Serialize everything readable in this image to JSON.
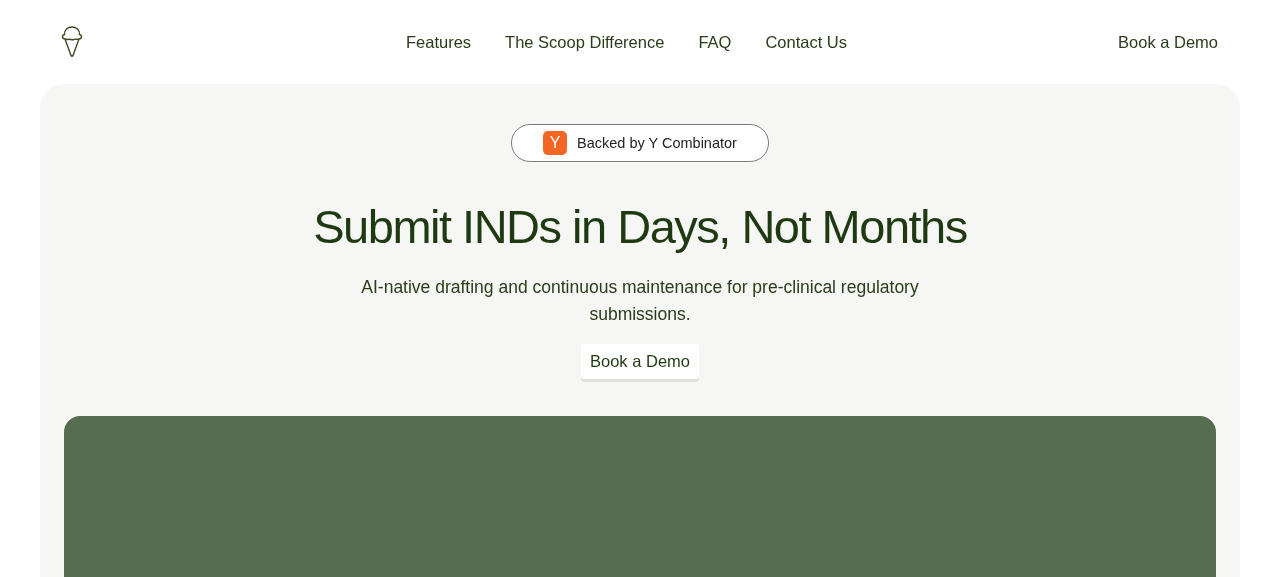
{
  "nav": {
    "links": [
      "Features",
      "The Scoop Difference",
      "FAQ",
      "Contact Us"
    ],
    "cta": "Book a Demo"
  },
  "hero": {
    "badge": {
      "mark": "Y",
      "label": "Backed by Y Combinator"
    },
    "title": "Submit INDs in Days, Not Months",
    "subtitle": "AI-native drafting and continuous maintenance for pre-clinical regulatory submissions.",
    "button": "Book a Demo"
  }
}
